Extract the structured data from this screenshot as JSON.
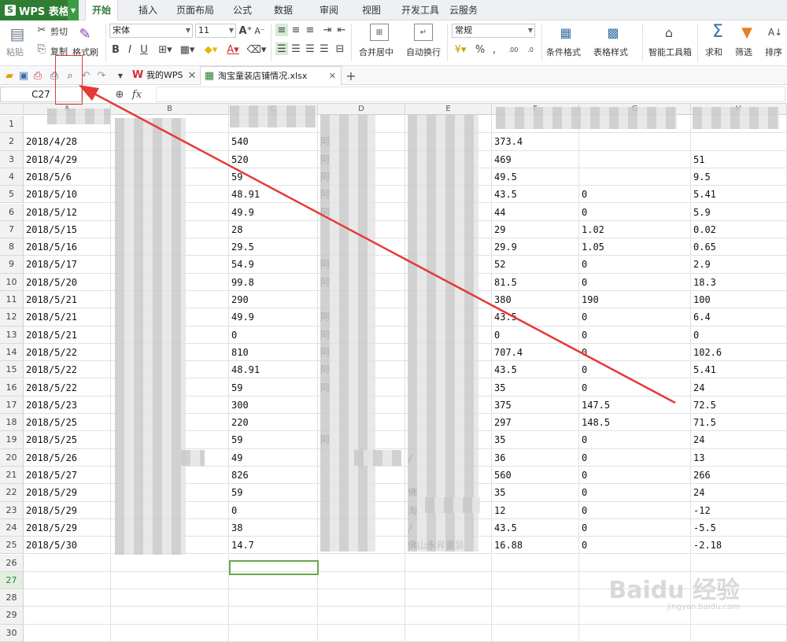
{
  "app": {
    "name": "WPS 表格",
    "file_tab": "淘宝童装店铺情况.xlsx",
    "home_tab": "我的WPS"
  },
  "menus": [
    "开始",
    "插入",
    "页面布局",
    "公式",
    "数据",
    "审阅",
    "视图",
    "开发工具",
    "云服务"
  ],
  "ribbon": {
    "cut": "剪切",
    "copy": "复制",
    "format_painter": "格式刷",
    "paste": "粘贴",
    "font": "宋体",
    "size": "11",
    "merge": "合并居中",
    "wrap": "自动换行",
    "numfmt": "常规",
    "cond": "条件格式",
    "table_style": "表格样式",
    "smart": "智能工具箱",
    "sum": "求和",
    "filter": "筛选",
    "sort": "排序"
  },
  "formula": {
    "namebox": "C27",
    "fx": "fx"
  },
  "columns": [
    "A",
    "B",
    "C",
    "D",
    "E",
    "F",
    "G",
    "H"
  ],
  "rows": [
    {
      "n": "1",
      "a": "",
      "c": "",
      "e": "",
      "f": "",
      "g": "",
      "h": ""
    },
    {
      "n": "2",
      "a": "2018/4/28",
      "c": "540",
      "d": "阿",
      "e": "",
      "f": "373.4",
      "g": "",
      "h": ""
    },
    {
      "n": "3",
      "a": "2018/4/29",
      "c": "520",
      "d": "阿",
      "e": "",
      "f": "469",
      "g": "",
      "h": "51"
    },
    {
      "n": "4",
      "a": "2018/5/6",
      "c": "59",
      "d": "阿",
      "e": "",
      "f": "49.5",
      "g": "",
      "h": "9.5"
    },
    {
      "n": "5",
      "a": "2018/5/10",
      "c": "48.91",
      "d": "阿",
      "e": "",
      "f": "43.5",
      "g": "0",
      "h": "5.41"
    },
    {
      "n": "6",
      "a": "2018/5/12",
      "c": "49.9",
      "d": "阿",
      "e": "",
      "f": "44",
      "g": "0",
      "h": "5.9"
    },
    {
      "n": "7",
      "a": "2018/5/15",
      "c": "28",
      "d": "",
      "e": "",
      "f": "29",
      "g": "1.02",
      "h": "0.02"
    },
    {
      "n": "8",
      "a": "2018/5/16",
      "c": "29.5",
      "d": "",
      "e": "",
      "f": "29.9",
      "g": "1.05",
      "h": "0.65"
    },
    {
      "n": "9",
      "a": "2018/5/17",
      "c": "54.9",
      "d": "阿",
      "e": "",
      "f": "52",
      "g": "0",
      "h": "2.9"
    },
    {
      "n": "10",
      "a": "2018/5/20",
      "c": "99.8",
      "d": "阿",
      "e": "",
      "f": "81.5",
      "g": "0",
      "h": "18.3"
    },
    {
      "n": "11",
      "a": "2018/5/21",
      "c": "290",
      "d": "",
      "e": "",
      "f": "380",
      "g": "190",
      "h": "100"
    },
    {
      "n": "12",
      "a": "2018/5/21",
      "c": "49.9",
      "d": "阿",
      "e": "",
      "f": "43.5",
      "g": "0",
      "h": "6.4"
    },
    {
      "n": "13",
      "a": "2018/5/21",
      "c": "0",
      "d": "阿",
      "e": "",
      "f": "0",
      "g": "0",
      "h": "0"
    },
    {
      "n": "14",
      "a": "2018/5/22",
      "c": "810",
      "d": "阿",
      "e": "",
      "f": "707.4",
      "g": "0",
      "h": "102.6"
    },
    {
      "n": "15",
      "a": "2018/5/22",
      "c": "48.91",
      "d": "阿",
      "e": "",
      "f": "43.5",
      "g": "0",
      "h": "5.41"
    },
    {
      "n": "16",
      "a": "2018/5/22",
      "c": "59",
      "d": "阿",
      "e": "",
      "f": "35",
      "g": "0",
      "h": "24"
    },
    {
      "n": "17",
      "a": "2018/5/23",
      "c": "300",
      "d": "",
      "e": "",
      "f": "375",
      "g": "147.5",
      "h": "72.5"
    },
    {
      "n": "18",
      "a": "2018/5/25",
      "c": "220",
      "d": "",
      "e": "",
      "f": "297",
      "g": "148.5",
      "h": "71.5"
    },
    {
      "n": "19",
      "a": "2018/5/25",
      "c": "59",
      "d": "阿",
      "e": "",
      "f": "35",
      "g": "0",
      "h": "24"
    },
    {
      "n": "20",
      "a": "2018/5/26",
      "c": "49",
      "d": "",
      "e": "/",
      "f": "36",
      "g": "0",
      "h": "13"
    },
    {
      "n": "21",
      "a": "2018/5/27",
      "c": "826",
      "d": "",
      "e": "",
      "f": "560",
      "g": "0",
      "h": "266"
    },
    {
      "n": "22",
      "a": "2018/5/29",
      "c": "59",
      "d": "",
      "e": "佛",
      "f": "35",
      "g": "0",
      "h": "24"
    },
    {
      "n": "23",
      "a": "2018/5/29",
      "c": "0",
      "d": "",
      "e": "淘",
      "f": "12",
      "g": "0",
      "h": "-12"
    },
    {
      "n": "24",
      "a": "2018/5/29",
      "c": "38",
      "d": "",
      "e": "/",
      "f": "43.5",
      "g": "0",
      "h": "-5.5"
    },
    {
      "n": "25",
      "a": "2018/5/30",
      "c": "14.7",
      "d": "",
      "e": "佛山永昇童装",
      "f": "16.88",
      "g": "0",
      "h": "-2.18"
    },
    {
      "n": "26",
      "a": "",
      "c": "",
      "e": "",
      "f": "",
      "g": "",
      "h": ""
    },
    {
      "n": "27",
      "a": "",
      "c": "",
      "e": "",
      "f": "",
      "g": "",
      "h": ""
    },
    {
      "n": "28",
      "a": "",
      "c": "",
      "e": "",
      "f": "",
      "g": "",
      "h": ""
    },
    {
      "n": "29",
      "a": "",
      "c": "",
      "e": "",
      "f": "",
      "g": "",
      "h": ""
    },
    {
      "n": "30",
      "a": "",
      "c": "",
      "e": "",
      "f": "",
      "g": "",
      "h": ""
    }
  ],
  "watermark": {
    "big": "Baidu 经验",
    "small": "jingyan.baidu.com"
  }
}
